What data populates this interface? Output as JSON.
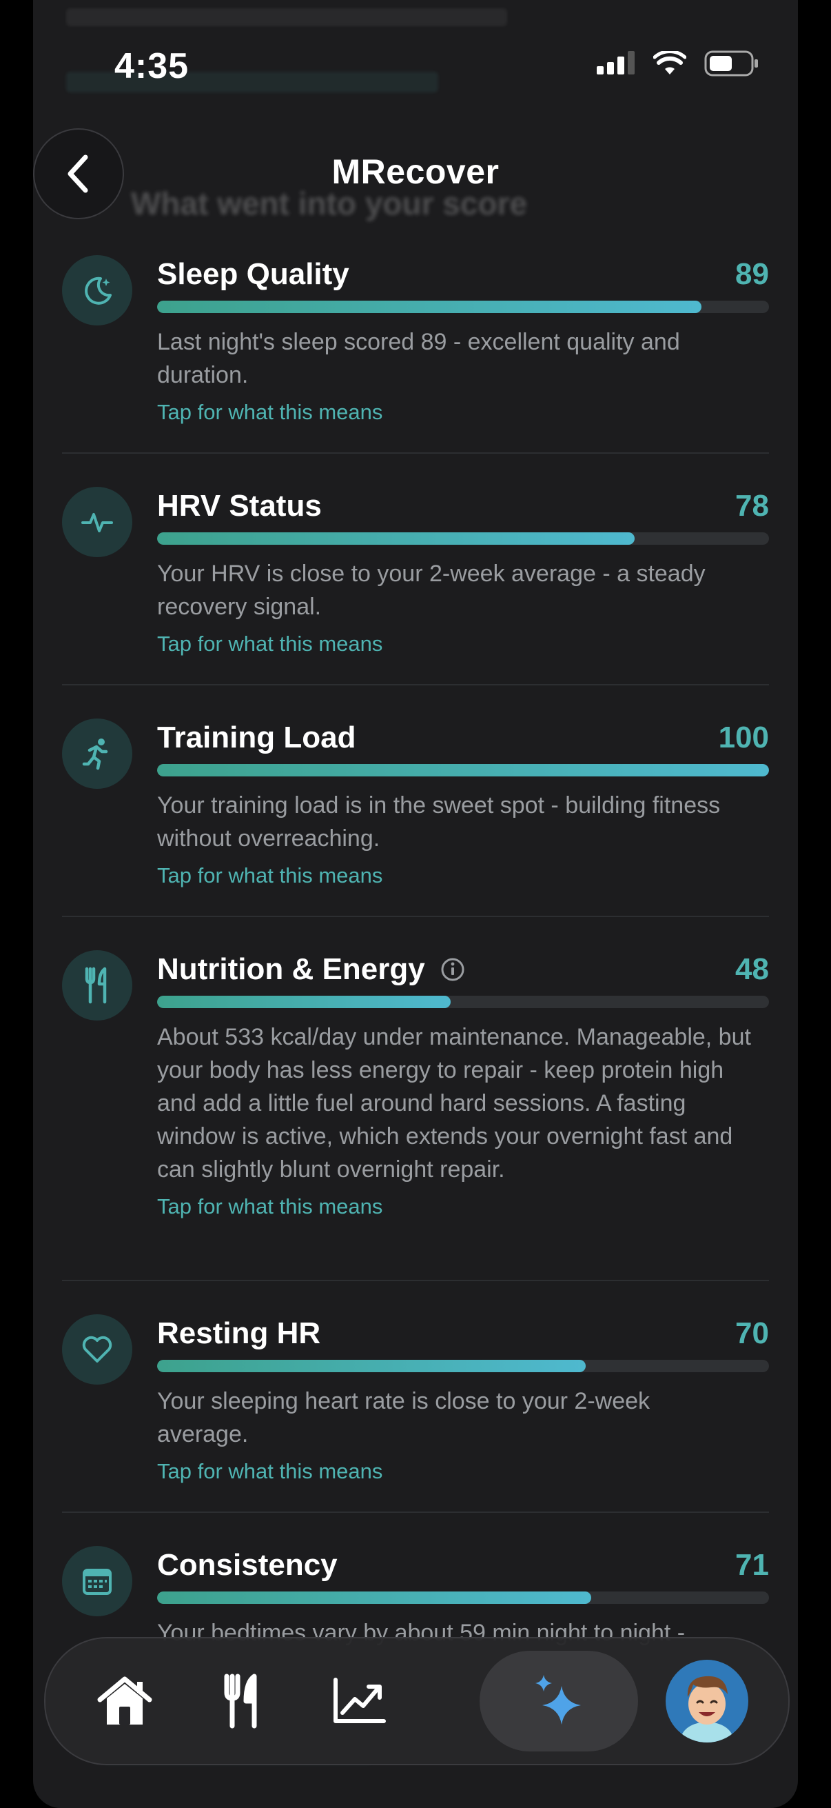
{
  "status_bar": {
    "time": "4:35"
  },
  "header": {
    "title": "MRecover",
    "section_title": "What went into your score"
  },
  "metrics": [
    {
      "name": "Sleep Quality",
      "score": "89",
      "progress": 0.89,
      "description": "Last night's sleep scored 89 - excellent quality and duration.",
      "link": "Tap for what this means",
      "icon": "moon-icon"
    },
    {
      "name": "HRV Status",
      "score": "78",
      "progress": 0.78,
      "description": "Your HRV is close to your 2-week average - a steady recovery signal.",
      "link": "Tap for what this means",
      "icon": "heartbeat-icon"
    },
    {
      "name": "Training Load",
      "score": "100",
      "progress": 1.0,
      "description": "Your training load is in the sweet spot - building fitness without overreaching.",
      "link": "Tap for what this means",
      "icon": "running-icon"
    },
    {
      "name": "Nutrition & Energy",
      "score": "48",
      "progress": 0.48,
      "description": "About 533 kcal/day under maintenance. Manageable, but your body has less energy to repair - keep protein high and add a little fuel around hard sessions. A fasting window is active, which extends your overnight fast and can slightly blunt overnight repair.",
      "link": "Tap for what this means",
      "icon": "fork-knife-icon"
    },
    {
      "name": "Resting HR",
      "score": "70",
      "progress": 0.7,
      "description": "Your sleeping heart rate is close to your 2-week average.",
      "link": "Tap for what this means",
      "icon": "heart-icon"
    },
    {
      "name": "Consistency",
      "score": "71",
      "progress": 0.71,
      "description": "Your bedtimes vary by about 59 min night to night -",
      "link": "",
      "icon": "calendar-icon"
    }
  ],
  "tabbar": {
    "tabs": [
      {
        "name": "home",
        "icon": "home-icon"
      },
      {
        "name": "nutrition",
        "icon": "fork-knife-icon"
      },
      {
        "name": "trends",
        "icon": "chart-icon"
      },
      {
        "name": "ai",
        "icon": "sparkles-icon",
        "active": true
      },
      {
        "name": "profile",
        "icon": "avatar"
      }
    ]
  },
  "colors": {
    "accent": "#4fb4b2",
    "accent_blue": "#4fa3e8",
    "card_bg": "#1c1c1e"
  }
}
